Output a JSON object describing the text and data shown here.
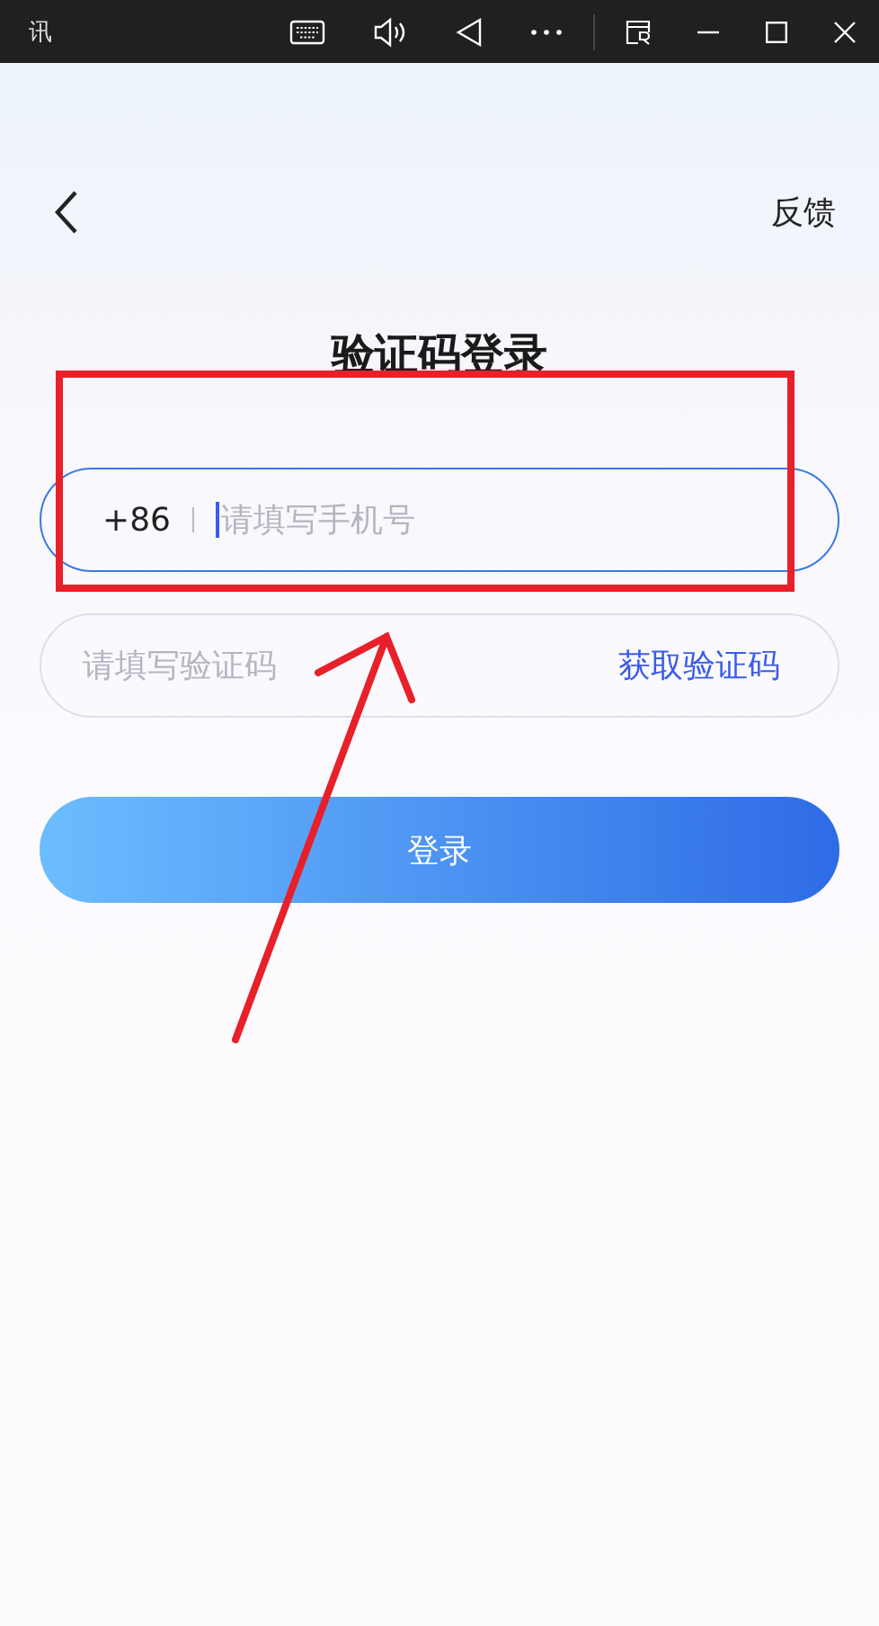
{
  "window": {
    "title": "讯"
  },
  "header": {
    "feedback": "反馈"
  },
  "title": "验证码登录",
  "phone_field": {
    "country_code": "+86",
    "placeholder": "请填写手机号",
    "focused": true
  },
  "code_field": {
    "placeholder": "请填写验证码",
    "get_code": "获取验证码"
  },
  "login_button": {
    "label": "登录"
  },
  "annotation": {
    "kind": "box-and-arrow",
    "color": "#e8202a"
  }
}
